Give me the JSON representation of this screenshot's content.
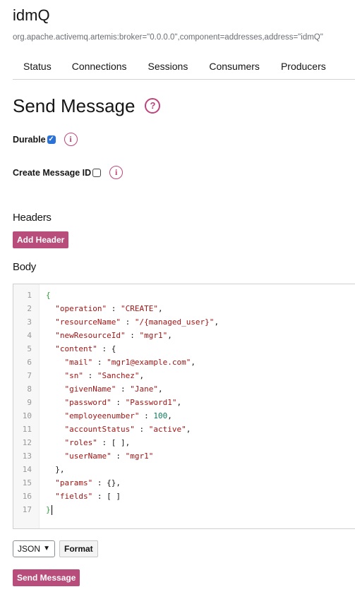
{
  "page": {
    "title": "idmQ",
    "subtitle": "org.apache.activemq.artemis:broker=\"0.0.0.0\",component=addresses,address=\"idmQ\""
  },
  "tabs": [
    "Status",
    "Connections",
    "Sessions",
    "Consumers",
    "Producers"
  ],
  "form": {
    "heading": "Send Message",
    "durable_label": "Durable",
    "durable_checked": true,
    "create_id_label": "Create Message ID",
    "create_id_checked": false,
    "headers_label": "Headers",
    "add_header_label": "Add Header",
    "body_label": "Body",
    "format_select_value": "JSON",
    "format_button_label": "Format",
    "send_button_label": "Send Message"
  },
  "editor": {
    "lines": [
      "{",
      "  \"operation\" : \"CREATE\",",
      "  \"resourceName\" : \"/{managed_user}\",",
      "  \"newResourceId\" : \"mgr1\",",
      "  \"content\" : {",
      "    \"mail\" : \"mgr1@example.com\",",
      "    \"sn\" : \"Sanchez\",",
      "    \"givenName\" : \"Jane\",",
      "    \"password\" : \"Password1\",",
      "    \"employeenumber\" : 100,",
      "    \"accountStatus\" : \"active\",",
      "    \"roles\" : [ ],",
      "    \"userName\" : \"mgr1\"",
      "  },",
      "  \"params\" : {},",
      "  \"fields\" : [ ]",
      "}"
    ]
  },
  "colors": {
    "accent": "#b84c7a",
    "help_icon": "#c0437c",
    "checkbox": "#2a72d8"
  },
  "icons": {
    "heading_help": "question-circle-icon",
    "durable_info": "info-circle-icon",
    "create_id_info": "info-circle-icon"
  }
}
